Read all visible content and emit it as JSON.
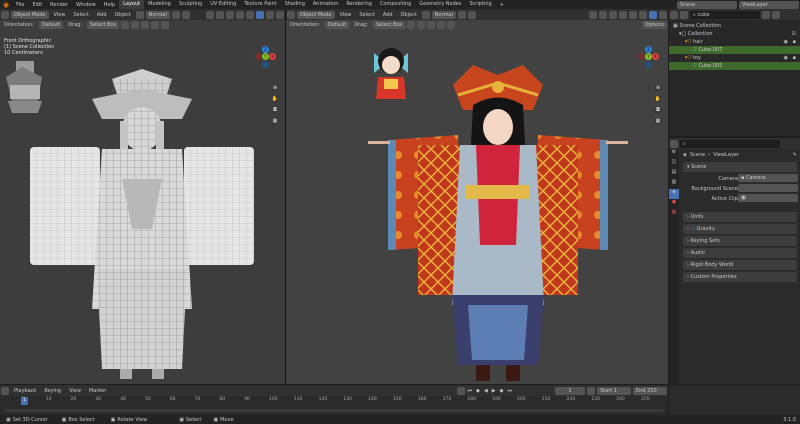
{
  "topbar": {
    "menus": [
      "File",
      "Edit",
      "Render",
      "Window",
      "Help"
    ],
    "workspaces": [
      "Layout",
      "Modeling",
      "Sculpting",
      "UV Editing",
      "Texture Paint",
      "Shading",
      "Animation",
      "Rendering",
      "Compositing",
      "Geometry Nodes",
      "Scripting"
    ],
    "active_workspace": "Layout",
    "scene_name": "Scene",
    "view_layer": "ViewLayer"
  },
  "left_viewport": {
    "header": {
      "mode": "Object Mode",
      "menus": [
        "View",
        "Select",
        "Add",
        "Object"
      ],
      "shading": "Normal"
    },
    "tool_header": {
      "orientation": "Orientation:",
      "orientation_value": "Default",
      "drag_label": "Drag:",
      "drag_value": "Select Box"
    },
    "overlay_text": [
      "Front Orthographic",
      "(1) Scene Collection",
      "10 Centimeters"
    ]
  },
  "right_viewport": {
    "header": {
      "mode": "Object Mode",
      "menus": [
        "View",
        "Select",
        "Add",
        "Object"
      ],
      "shading": "Normal"
    },
    "tool_header": {
      "orientation": "Orientation:",
      "orientation_value": "Default",
      "drag_label": "Drag:",
      "drag_value": "Select Box",
      "options": "Options"
    }
  },
  "gizmo": {
    "x": "X",
    "y": "Y",
    "z": "Z"
  },
  "outliner": {
    "search_value": "cube",
    "rows": [
      {
        "label": "Scene Collection",
        "indent": 0,
        "selected": false
      },
      {
        "label": "Collection",
        "indent": 1,
        "selected": false
      },
      {
        "label": "hair",
        "indent": 2,
        "selected": false
      },
      {
        "label": "Cube.007",
        "indent": 3,
        "selected": true
      },
      {
        "label": "toy",
        "indent": 2,
        "selected": false
      },
      {
        "label": "Cube.005",
        "indent": 3,
        "selected": true
      }
    ]
  },
  "properties": {
    "breadcrumb_scene": "Scene",
    "breadcrumb_layer": "ViewLayer",
    "panel_title": "Scene",
    "camera_label": "Camera",
    "camera_value": "Camera",
    "background_label": "Background Scene",
    "clip_label": "Active Clip",
    "sections": [
      "Units",
      "Gravity",
      "Keying Sets",
      "Audio",
      "Rigid Body World",
      "Custom Properties"
    ]
  },
  "timeline": {
    "menus": [
      "Playback",
      "Keying",
      "View",
      "Marker"
    ],
    "current_frame": "1",
    "start_label": "Start",
    "start_value": "1",
    "end_label": "End",
    "end_value": "250",
    "ticks": [
      "0",
      "10",
      "20",
      "30",
      "40",
      "50",
      "60",
      "70",
      "80",
      "90",
      "100",
      "110",
      "120",
      "130",
      "140",
      "150",
      "160",
      "170",
      "180",
      "190",
      "200",
      "210",
      "220",
      "230",
      "240",
      "250"
    ],
    "playhead": "1"
  },
  "statusbar": {
    "items": [
      "Set 3D Cursor",
      "Box Select",
      "Rotate View",
      "Select",
      "Move"
    ],
    "version": "3.1.0"
  },
  "colors": {
    "accent_blue": "#4772b3",
    "selected_green": "#3e6b2d",
    "viewport_bg": "#3d3d3d"
  }
}
